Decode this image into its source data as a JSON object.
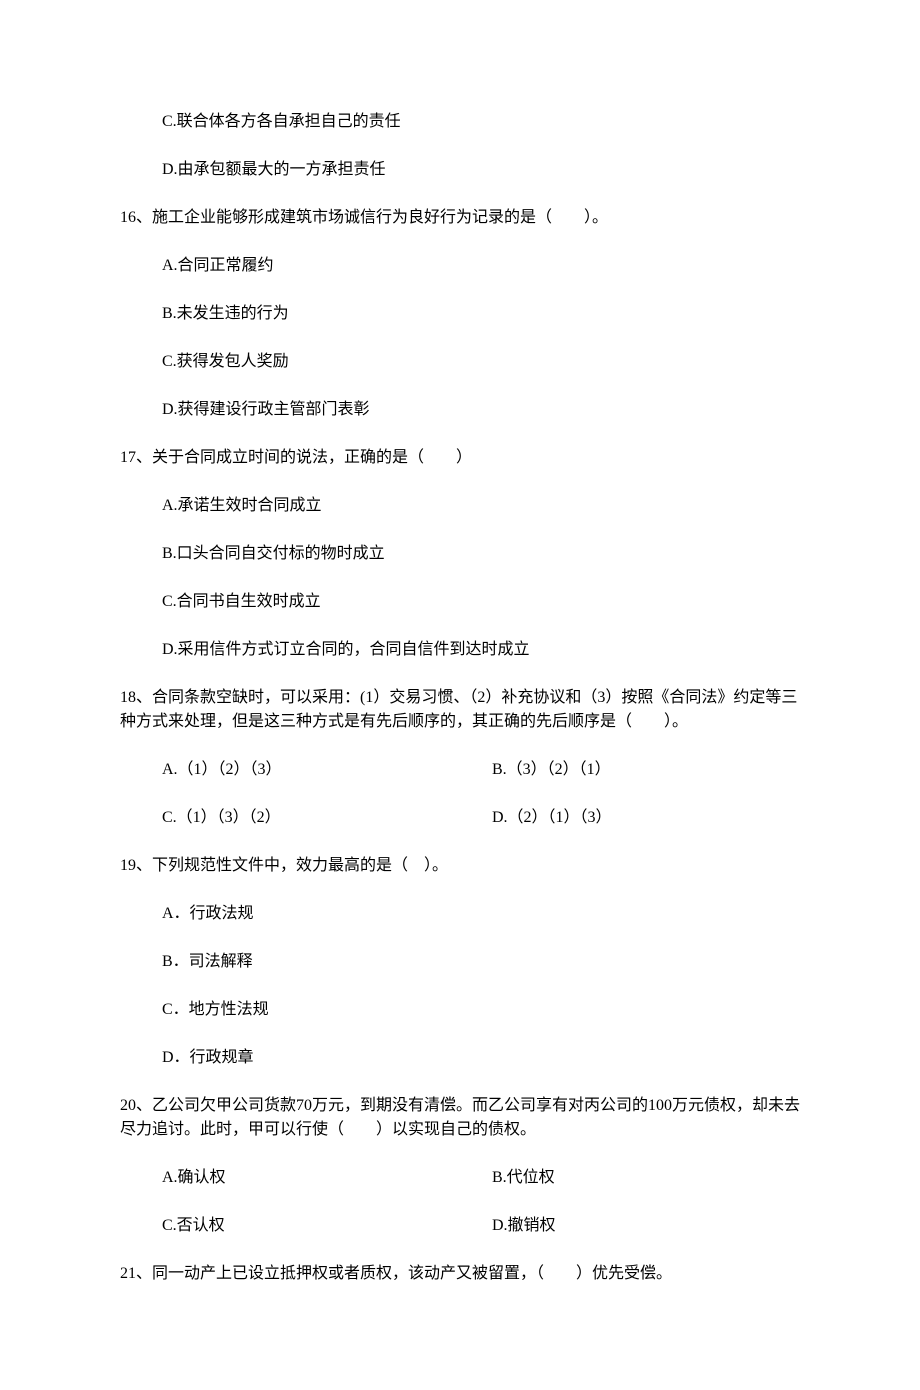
{
  "q15": {
    "optC": "C.联合体各方各自承担自己的责任",
    "optD": "D.由承包额最大的一方承担责任"
  },
  "q16": {
    "stem": "16、施工企业能够形成建筑市场诚信行为良好行为记录的是（　　）。",
    "optA": "A.合同正常履约",
    "optB": "B.未发生违的行为",
    "optC": "C.获得发包人奖励",
    "optD": "D.获得建设行政主管部门表彰"
  },
  "q17": {
    "stem": "17、关于合同成立时间的说法，正确的是（　　）",
    "optA": "A.承诺生效时合同成立",
    "optB": "B.口头合同自交付标的物时成立",
    "optC": "C.合同书自生效时成立",
    "optD": "D.采用信件方式订立合同的，合同自信件到达时成立"
  },
  "q18": {
    "stem": "18、合同条款空缺时，可以采用：(1）交易习惯、（2）补充协议和（3）按照《合同法》约定等三种方式来处理，但是这三种方式是有先后顺序的，其正确的先后顺序是（　　）。",
    "optA": "A.（1）（2）（3）",
    "optB": "B.（3）（2）（1）",
    "optC": "C.（1）（3）（2）",
    "optD": "D.（2）（1）（3）"
  },
  "q19": {
    "stem": "19、下列规范性文件中，效力最高的是（　）。",
    "optA": "A．行政法规",
    "optB": "B．司法解释",
    "optC": "C．地方性法规",
    "optD": "D．行政规章"
  },
  "q20": {
    "stem": "20、乙公司欠甲公司货款70万元，到期没有清偿。而乙公司享有对丙公司的100万元债权，却未去尽力追讨。此时，甲可以行使（　　）以实现自己的债权。",
    "optA": "A.确认权",
    "optB": "B.代位权",
    "optC": "C.否认权",
    "optD": "D.撤销权"
  },
  "q21": {
    "stem": "21、同一动产上已设立抵押权或者质权，该动产又被留置，（　　）优先受偿。"
  }
}
